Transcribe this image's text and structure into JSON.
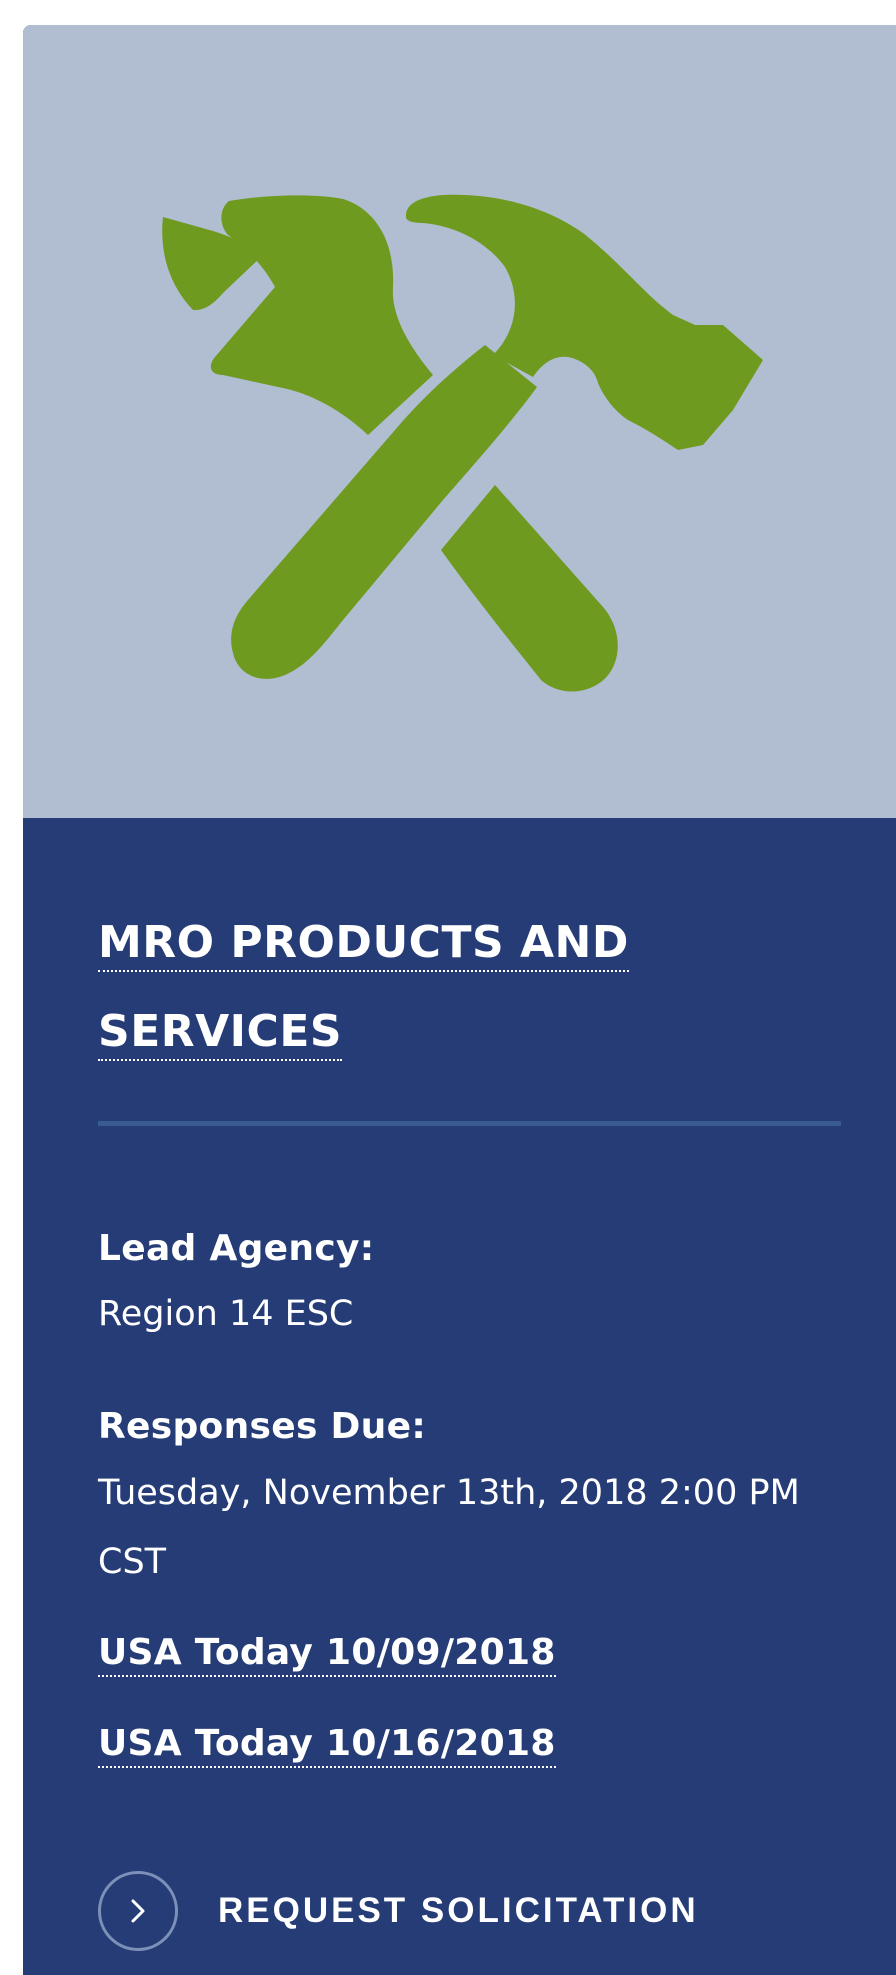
{
  "card": {
    "icon": "tools-hammer-wrench-icon",
    "colors": {
      "hero_bg": "#b1bdd0",
      "icon_green": "#6e9a20",
      "panel_bg": "#253c77",
      "divider": "#3a5a92"
    },
    "title": "MRO PRODUCTS AND SERVICES",
    "lead_agency_label": "Lead Agency:",
    "lead_agency_value": "Region 14 ESC",
    "responses_due_label": "Responses Due:",
    "responses_due_value": "Tuesday, November 13th, 2018 2:00 PM CST",
    "links": [
      {
        "label": "USA Today 10/09/2018"
      },
      {
        "label": "USA Today 10/16/2018"
      }
    ],
    "cta": {
      "icon": "chevron-right-icon",
      "label": "REQUEST SOLICITATION"
    }
  }
}
